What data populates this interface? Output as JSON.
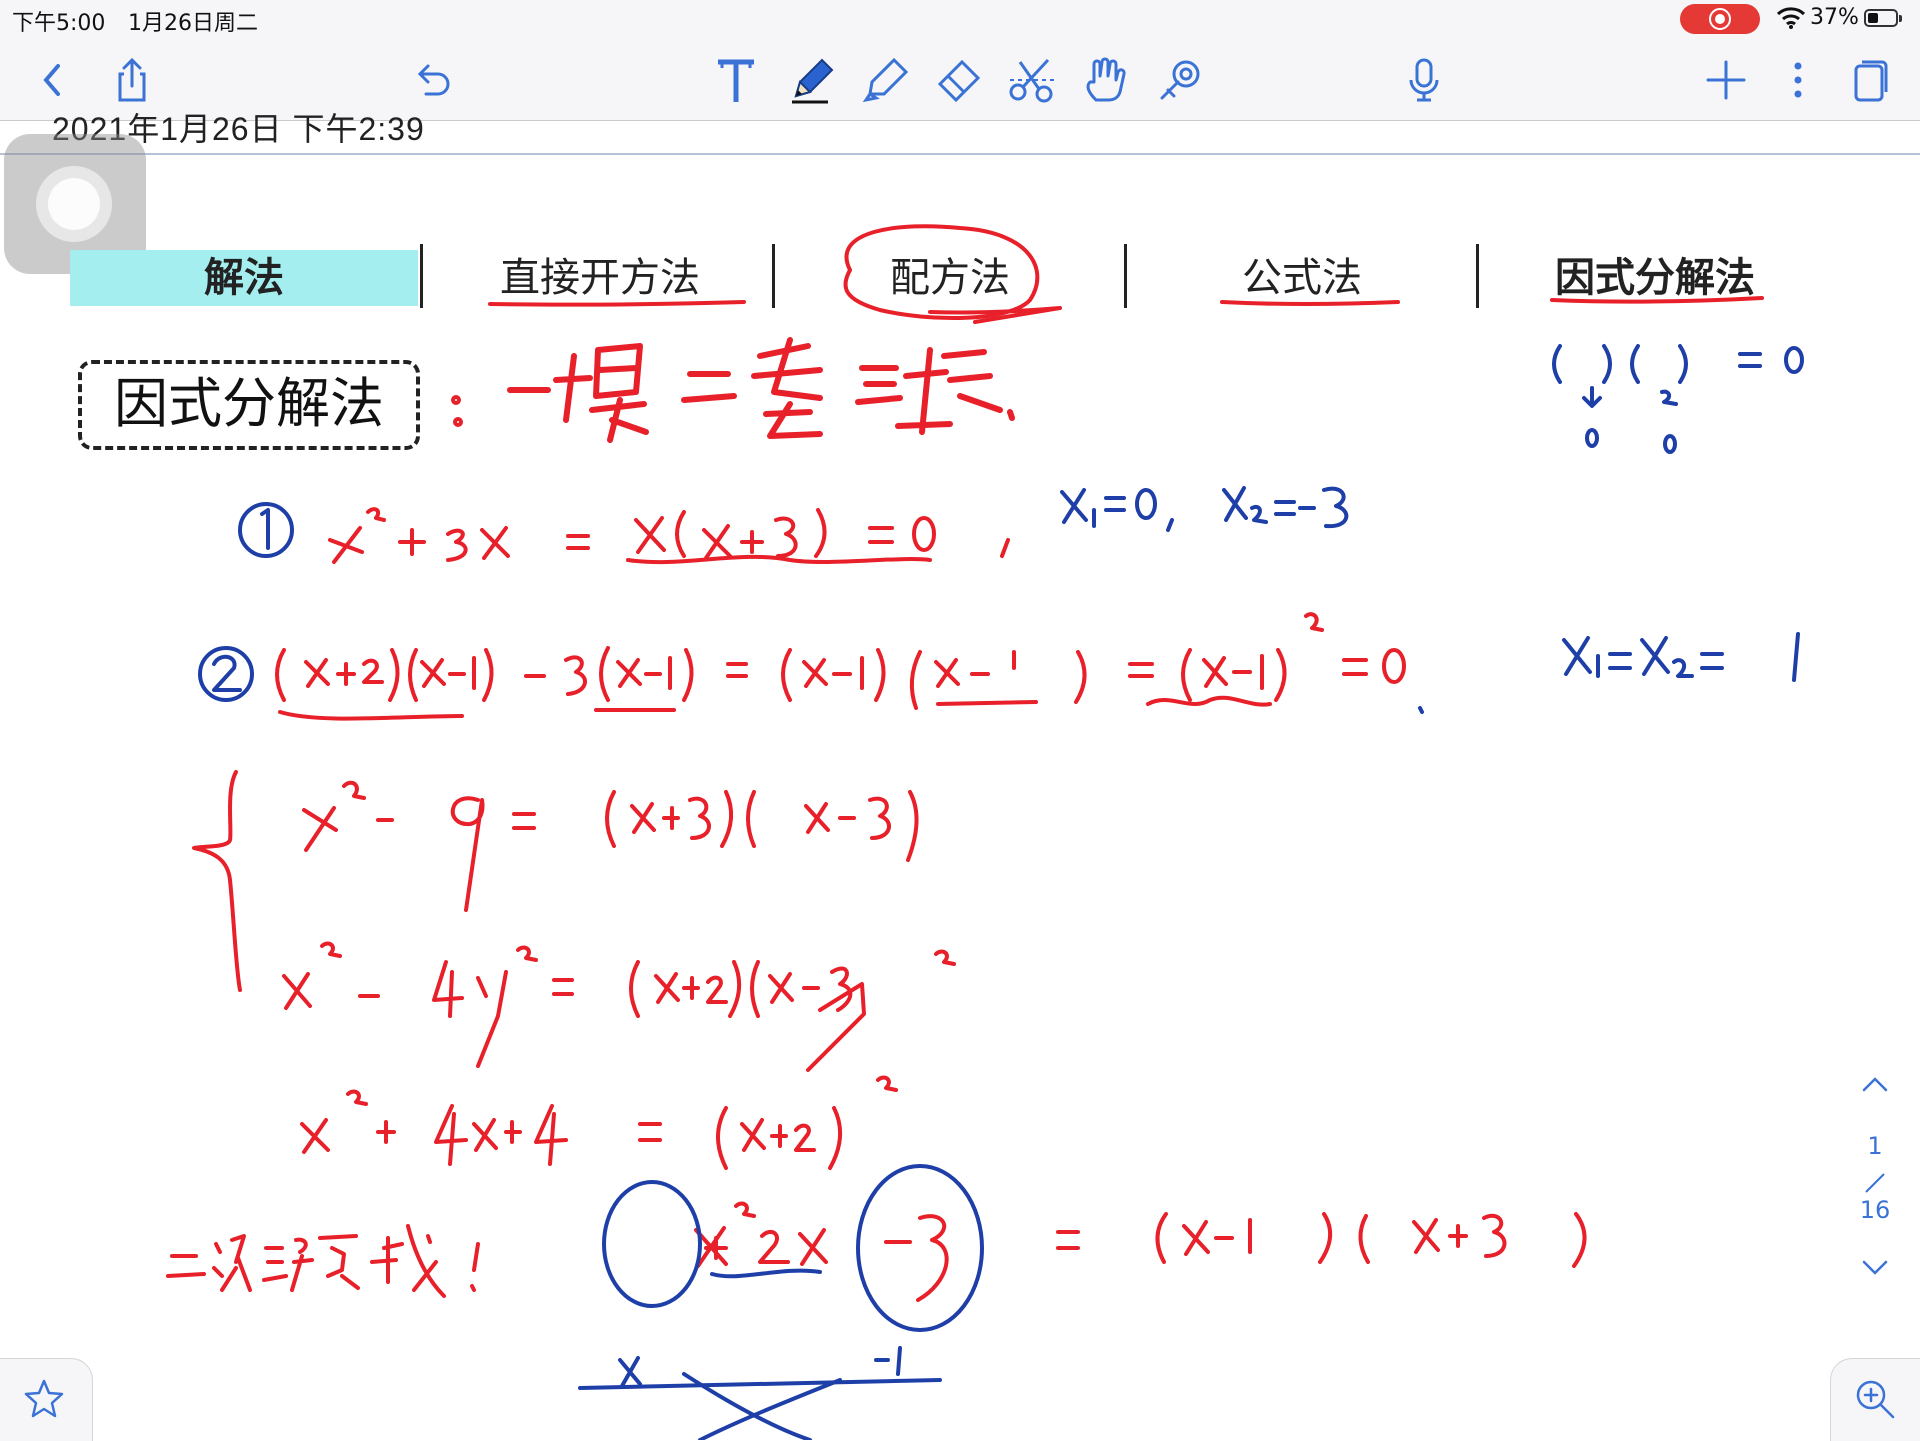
{
  "status": {
    "time": "下午5:00",
    "date": "1月26日周二",
    "battery_text": "37%",
    "battery_level": 0.37,
    "recording": true
  },
  "toolbar": {
    "left": [
      "back-icon",
      "share-icon",
      "undo-icon"
    ],
    "tools": [
      "text-tool-icon",
      "pen-icon",
      "highlighter-icon",
      "eraser-icon",
      "scissors-icon",
      "hand-icon",
      "laser-icon"
    ],
    "right": [
      "microphone-icon",
      "add-page-icon",
      "more-icon",
      "pages-icon"
    ]
  },
  "note": {
    "date_line": "2021年1月26日 下午2:39",
    "methods": [
      "解法",
      "直接开方法",
      "配方法",
      "公式法",
      "因式分解法"
    ],
    "section_title": "因式分解法"
  },
  "pager": {
    "current": "1",
    "slash": "/",
    "total": "16"
  },
  "colors": {
    "accent": "#3a72d6",
    "highlight": "#a5eef0",
    "ink_red": "#e8202a",
    "ink_blue": "#1e3fa8"
  }
}
